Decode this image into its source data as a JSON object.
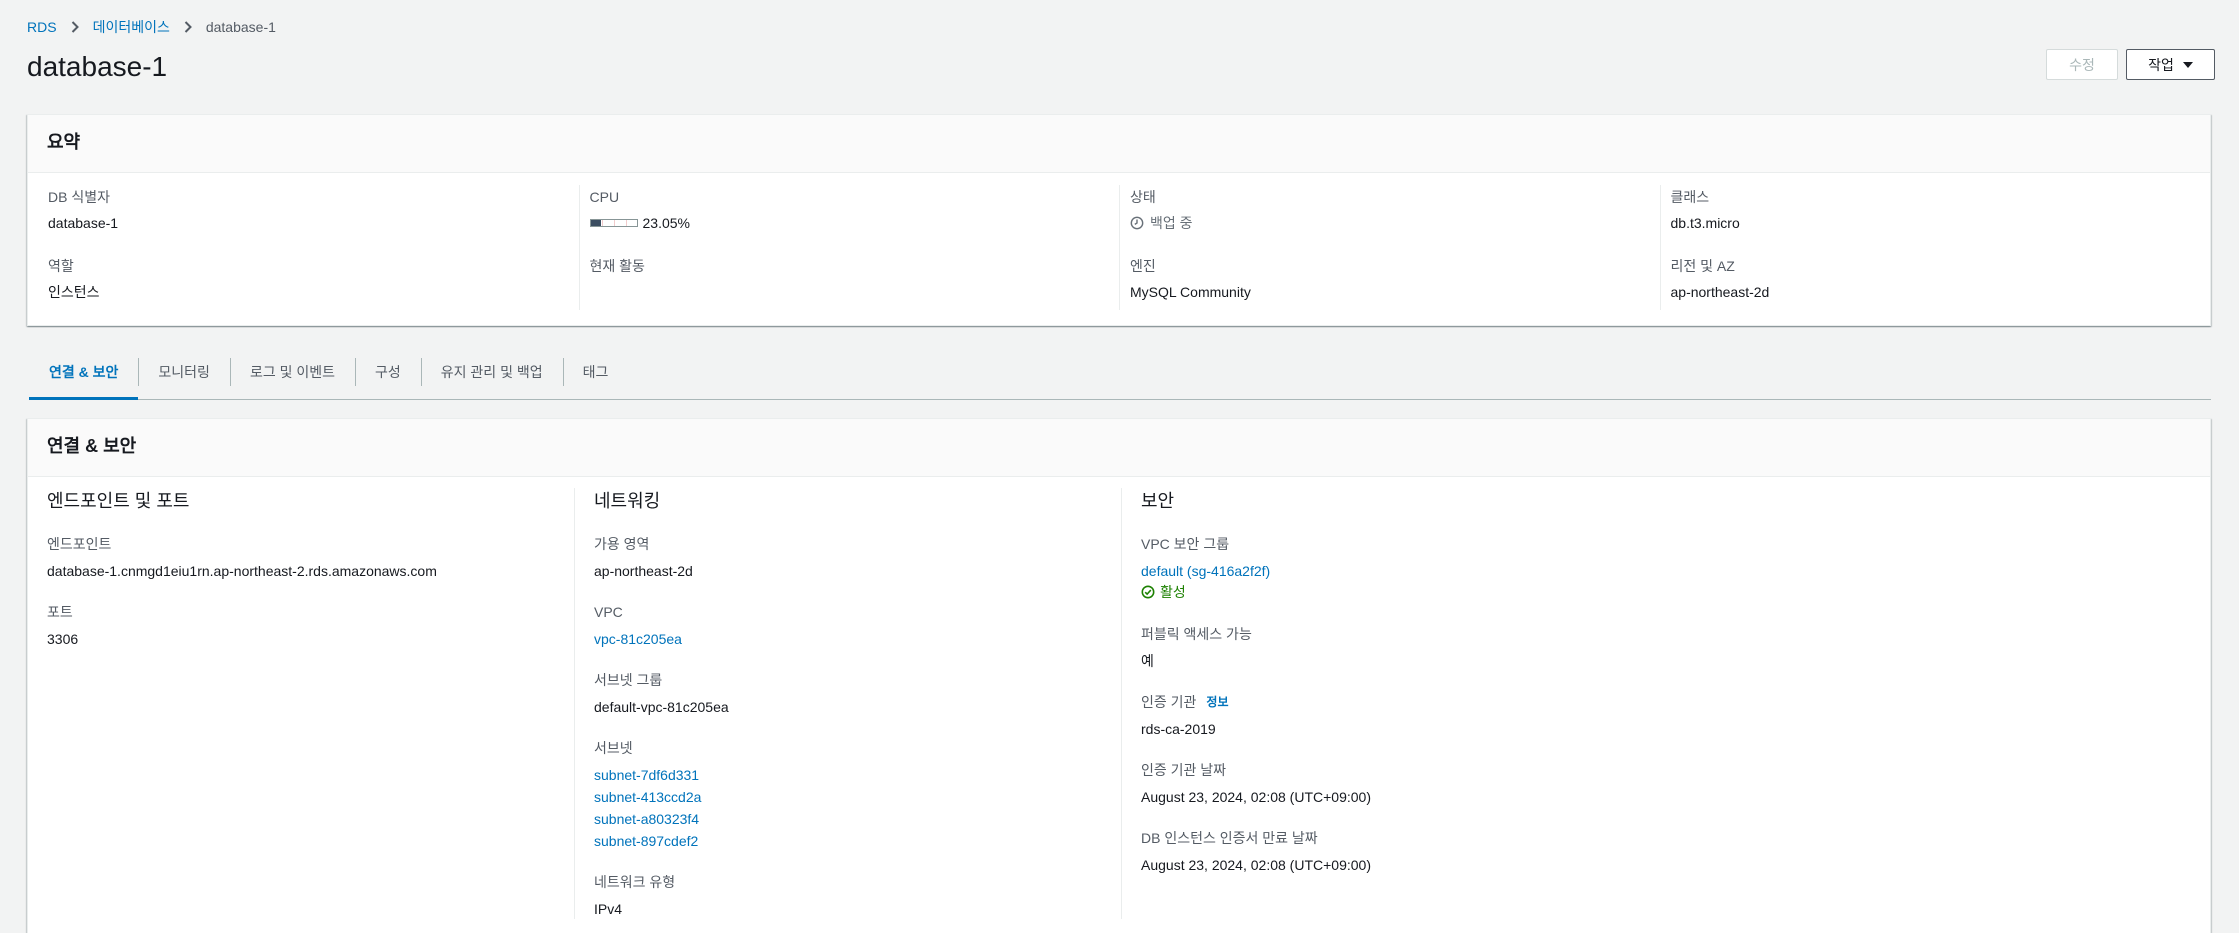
{
  "breadcrumb": {
    "items": [
      {
        "label": "RDS"
      },
      {
        "label": "데이터베이스"
      },
      {
        "label": "database-1"
      }
    ],
    "separator_icon": "chevron-right-icon"
  },
  "header": {
    "title": "database-1",
    "edit_button": {
      "label": "수정",
      "disabled": true
    },
    "actions_button": {
      "label": "작업",
      "icon": "caret-down-icon"
    }
  },
  "summary": {
    "title": "요약",
    "fields": {
      "db_identifier": {
        "label": "DB 식별자",
        "value": "database-1"
      },
      "role": {
        "label": "역할",
        "value": "인스턴스"
      },
      "cpu": {
        "label": "CPU",
        "percent": 23.05,
        "value": "23.05%"
      },
      "current_activity": {
        "label": "현재 활동"
      },
      "status": {
        "label": "상태",
        "value": "백업 중",
        "icon": "clock-icon"
      },
      "engine": {
        "label": "엔진",
        "value": "MySQL Community"
      },
      "class": {
        "label": "클래스",
        "value": "db.t3.micro"
      },
      "region_az": {
        "label": "리전 및 AZ",
        "value": "ap-northeast-2d"
      }
    }
  },
  "tabs": {
    "active_index": 0,
    "items": [
      {
        "label": "연결 & 보안"
      },
      {
        "label": "모니터링"
      },
      {
        "label": "로그 및 이벤트"
      },
      {
        "label": "구성"
      },
      {
        "label": "유지 관리 및 백업"
      },
      {
        "label": "태그"
      }
    ]
  },
  "connectivity": {
    "title": "연결 & 보안",
    "endpoint_port": {
      "heading": "엔드포인트 및 포트",
      "endpoint": {
        "label": "엔드포인트",
        "value": "database-1.cnmgd1eiu1rn.ap-northeast-2.rds.amazonaws.com"
      },
      "port": {
        "label": "포트",
        "value": "3306"
      }
    },
    "networking": {
      "heading": "네트워킹",
      "availability_zone": {
        "label": "가용 영역",
        "value": "ap-northeast-2d"
      },
      "vpc": {
        "label": "VPC",
        "value": "vpc-81c205ea"
      },
      "subnet_group": {
        "label": "서브넷 그룹",
        "value": "default-vpc-81c205ea"
      },
      "subnets": {
        "label": "서브넷",
        "values": [
          "subnet-7df6d331",
          "subnet-413ccd2a",
          "subnet-a80323f4",
          "subnet-897cdef2"
        ]
      },
      "network_type": {
        "label": "네트워크 유형",
        "value": "IPv4"
      }
    },
    "security": {
      "heading": "보안",
      "vpc_security_groups": {
        "label": "VPC 보안 그룹",
        "value": "default (sg-416a2f2f)",
        "status": "활성",
        "status_icon": "check-circle-icon"
      },
      "publicly_accessible": {
        "label": "퍼블릭 액세스 가능",
        "value": "예"
      },
      "certificate_authority": {
        "label": "인증 기관",
        "info_link": "정보",
        "value": "rds-ca-2019"
      },
      "ca_date": {
        "label": "인증 기관 날짜",
        "value": "August 23, 2024, 02:08 (UTC+09:00)"
      },
      "cert_expiry": {
        "label": "DB 인스턴스 인증서 만료 날짜",
        "value": "August 23, 2024, 02:08 (UTC+09:00)"
      }
    }
  },
  "colors": {
    "page_background": "#f2f3f3",
    "text": "#16191f",
    "label": "#545b64",
    "link": "#0073bb",
    "success": "#1d8102",
    "muted": "#687078",
    "cpu_fill": "#3b4d61"
  }
}
